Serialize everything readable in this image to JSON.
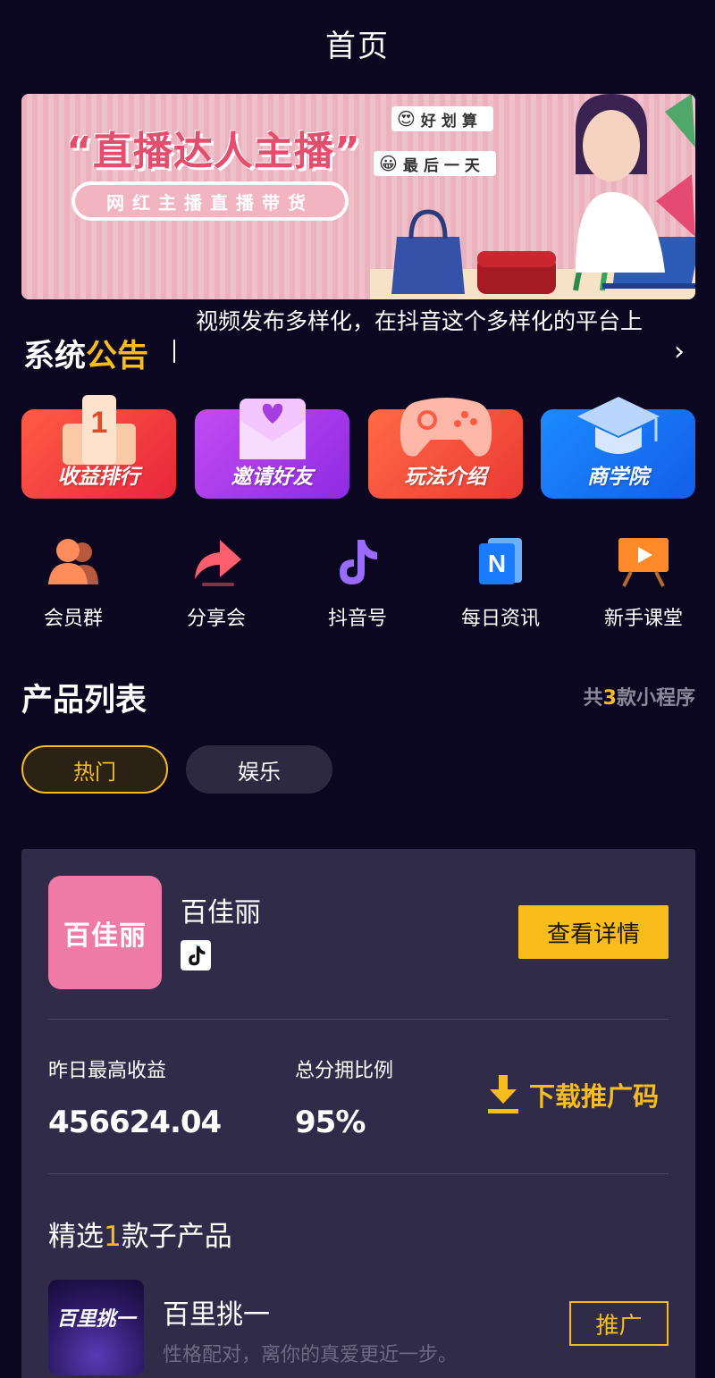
{
  "header": {
    "title": "首页"
  },
  "banner": {
    "title": "“直播达人主播”",
    "subtitle": "网红主播直播带货",
    "bubble1": "好划算",
    "bubble2": "最后一天"
  },
  "notice": {
    "title_prefix": "系统",
    "title_highlight": "公告",
    "text": "视频发布多样化，在抖音这个多样化的平台上"
  },
  "cards": [
    {
      "label": "收益排行",
      "icon": "trophy-icon",
      "color": "#f03a3a"
    },
    {
      "label": "邀请好友",
      "icon": "envelope-heart-icon",
      "color": "#b13cf0"
    },
    {
      "label": "玩法介绍",
      "icon": "gamepad-icon",
      "color": "#f0503a"
    },
    {
      "label": "商学院",
      "icon": "graduation-cap-icon",
      "color": "#1a6ff0"
    }
  ],
  "shortcuts": [
    {
      "label": "会员群",
      "icon": "people-icon"
    },
    {
      "label": "分享会",
      "icon": "share-arrow-icon"
    },
    {
      "label": "抖音号",
      "icon": "tiktok-note-icon"
    },
    {
      "label": "每日资讯",
      "icon": "news-icon"
    },
    {
      "label": "新手课堂",
      "icon": "classroom-board-icon"
    }
  ],
  "product_list": {
    "title": "产品列表",
    "count_prefix": "共",
    "count": "3",
    "count_suffix": "款小程序",
    "tabs": [
      {
        "label": "热门",
        "active": true
      },
      {
        "label": "娱乐",
        "active": false
      }
    ]
  },
  "product": {
    "logo_text": "百佳丽",
    "name": "百佳丽",
    "detail_button": "查看详情",
    "stat1_label": "昨日最高收益",
    "stat1_value": "456624.04",
    "stat2_label": "总分拥比例",
    "stat2_value": "95%",
    "download_label": "下载推广码",
    "sub_heading_prefix": "精选",
    "sub_heading_count": "1",
    "sub_heading_suffix": "款子产品",
    "sub_product": {
      "logo_text": "百里挑一",
      "name": "百里挑一",
      "desc": "性格配对，离你的真爱更近一步。",
      "button": "推广"
    }
  },
  "colors": {
    "background": "#0c0720",
    "accent": "#f8bd1c",
    "card": "#302b49"
  }
}
